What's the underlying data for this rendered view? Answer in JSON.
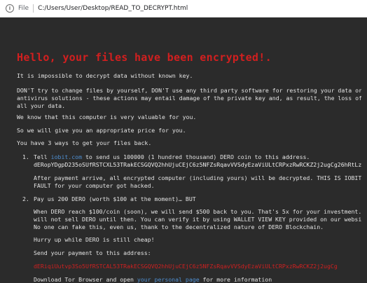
{
  "browser": {
    "file_label": "File",
    "url": "C:/Users/User/Desktop/READ_TO_DECRYPT.html"
  },
  "note": {
    "title": "Hello, your files have been encrypted!.",
    "p1": "It is impossible to decrypt data without known key.",
    "p2_l1": "DON'T try to change files by yourself, DON'T use any third party software for restoring your data or",
    "p2_l2": "antivirus solutions - these actions may entail damage of the private key and, as result, the loss of",
    "p2_l3": "all your data.",
    "p3": "We know that this computer is very valuable for you.",
    "p4": "So we will give you an appropriate price for you.",
    "p5": "You have 3 ways to get your files back.",
    "way1": {
      "num": "1.",
      "pre": "Tell ",
      "link": "iobit.com",
      "post": " to send us 100000 (1 hundred thousand) DERO coin to this address.",
      "address": "dERopYDgpD235oSUfRSTCXL53TRakECSGQVQ2hhUjuCEjC6z5NFZsRqavVVSdyEzaViULtCRPxzRwRCKZ2j2ugCg26hRtLziwu",
      "after_l1": "After payment arrive, all encrypted computer (including yours) will be decrypted. THIS IS IOBIT's",
      "after_l2": "FAULT for your computer got hacked."
    },
    "way2": {
      "num": "2.",
      "line": "Pay us 200 DERO (worth $100 at the moment)… BUT",
      "d1": "When DERO reach $100/coin (soon), we will send $500 back to you. That's 5x for your investment. We",
      "d2": "will not sell DERO until then. You can verify it by using WALLET VIEW KEY provided on our website.",
      "d3": "No one can fake this, even us, thank to the decentralized nature of DERO Blockchain.",
      "hurry": "Hurry up while DERO is still cheap!",
      "send": "Send your payment to this address:",
      "address": "dERiqiUutvp3So5UfRSTCAL53TRakECSGQVQ2hhUjuCEjC6z5NFZsRqavVVSdyEzaViULtCRPxzRwRCKZ2j2ugCg",
      "dl_pre": "Download Tor Browser and open ",
      "dl_link": "your personal page",
      "dl_post": " for more information"
    }
  }
}
